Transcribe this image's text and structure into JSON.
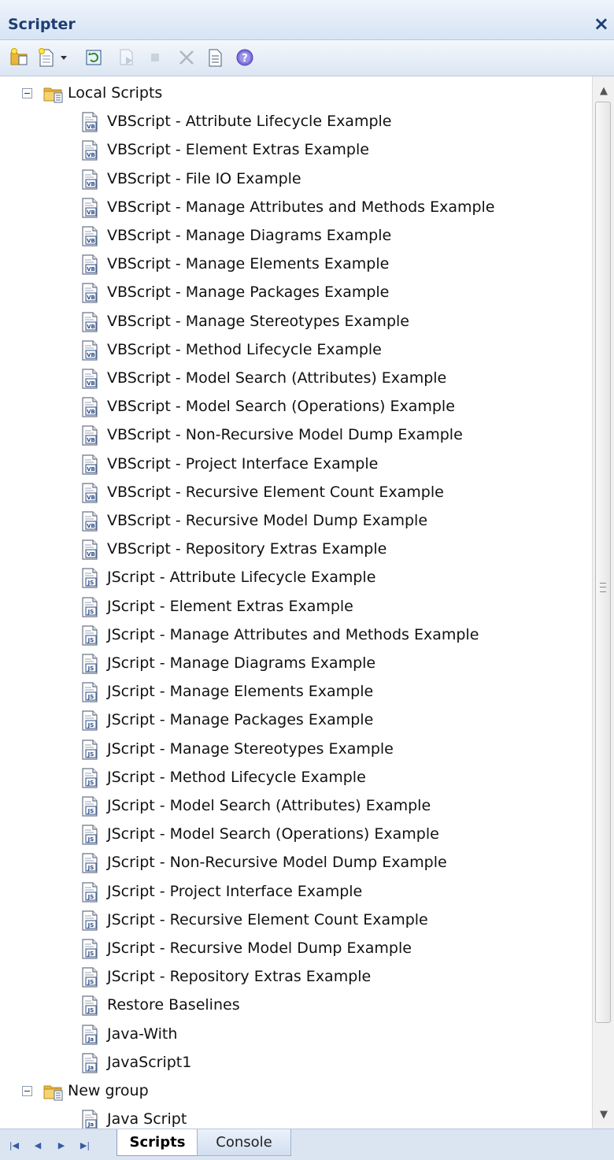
{
  "window": {
    "title": "Scripter",
    "close_glyph": "×"
  },
  "toolbar": {
    "buttons": [
      {
        "name": "new-group-button",
        "icon": "new-group-icon",
        "enabled": true
      },
      {
        "name": "new-script-button",
        "icon": "new-script-icon",
        "enabled": true
      },
      {
        "name": "new-script-dropdown",
        "icon": "chevron-down-icon",
        "enabled": true
      },
      {
        "name": "refresh-button",
        "icon": "refresh-icon",
        "enabled": true
      },
      {
        "name": "run-script-button",
        "icon": "run-script-icon",
        "enabled": false
      },
      {
        "name": "stop-script-button",
        "icon": "stop-icon",
        "enabled": false
      },
      {
        "name": "delete-button",
        "icon": "delete-icon",
        "enabled": false
      },
      {
        "name": "properties-button",
        "icon": "properties-icon",
        "enabled": true
      },
      {
        "name": "help-button",
        "icon": "help-icon",
        "enabled": true
      }
    ]
  },
  "tree": {
    "groups": [
      {
        "label": "Local Scripts",
        "expanded": true,
        "items": [
          {
            "label": "VBScript - Attribute Lifecycle Example",
            "type": "VB"
          },
          {
            "label": "VBScript - Element Extras Example",
            "type": "VB"
          },
          {
            "label": "VBScript - File IO Example",
            "type": "VB"
          },
          {
            "label": "VBScript - Manage Attributes and Methods Example",
            "type": "VB"
          },
          {
            "label": "VBScript - Manage Diagrams Example",
            "type": "VB"
          },
          {
            "label": "VBScript - Manage Elements Example",
            "type": "VB"
          },
          {
            "label": "VBScript - Manage Packages Example",
            "type": "VB"
          },
          {
            "label": "VBScript - Manage Stereotypes Example",
            "type": "VB"
          },
          {
            "label": "VBScript - Method Lifecycle Example",
            "type": "VB"
          },
          {
            "label": "VBScript - Model Search (Attributes) Example",
            "type": "VB"
          },
          {
            "label": "VBScript - Model Search (Operations) Example",
            "type": "VB"
          },
          {
            "label": "VBScript - Non-Recursive Model Dump Example",
            "type": "VB"
          },
          {
            "label": "VBScript - Project Interface Example",
            "type": "VB"
          },
          {
            "label": "VBScript - Recursive Element Count Example",
            "type": "VB"
          },
          {
            "label": "VBScript - Recursive Model Dump Example",
            "type": "VB"
          },
          {
            "label": "VBScript - Repository Extras Example",
            "type": "VB"
          },
          {
            "label": "JScript - Attribute Lifecycle Example",
            "type": "JS"
          },
          {
            "label": "JScript - Element Extras Example",
            "type": "JS"
          },
          {
            "label": "JScript - Manage Attributes and Methods Example",
            "type": "JS"
          },
          {
            "label": "JScript - Manage Diagrams Example",
            "type": "JS"
          },
          {
            "label": "JScript - Manage Elements Example",
            "type": "JS"
          },
          {
            "label": "JScript - Manage Packages Example",
            "type": "JS"
          },
          {
            "label": "JScript - Manage Stereotypes Example",
            "type": "JS"
          },
          {
            "label": "JScript - Method Lifecycle Example",
            "type": "JS"
          },
          {
            "label": "JScript - Model Search (Attributes) Example",
            "type": "JS"
          },
          {
            "label": "JScript - Model Search (Operations) Example",
            "type": "JS"
          },
          {
            "label": "JScript - Non-Recursive Model Dump Example",
            "type": "JS"
          },
          {
            "label": "JScript - Project Interface Example",
            "type": "JS"
          },
          {
            "label": "JScript - Recursive Element Count Example",
            "type": "JS"
          },
          {
            "label": "JScript - Recursive Model Dump Example",
            "type": "JS"
          },
          {
            "label": "JScript - Repository Extras Example",
            "type": "JS"
          },
          {
            "label": "Restore Baselines",
            "type": "JS"
          },
          {
            "label": "Java-With",
            "type": "Ja"
          },
          {
            "label": "JavaScript1",
            "type": "Ja"
          }
        ]
      },
      {
        "label": "New group",
        "expanded": true,
        "items": [
          {
            "label": "Java Script",
            "type": "Ja"
          }
        ]
      }
    ]
  },
  "scrollbar": {
    "up_glyph": "▲",
    "down_glyph": "▼"
  },
  "bottom": {
    "nav": [
      "|◀",
      "◀",
      "▶",
      "▶|"
    ],
    "tabs": [
      {
        "label": "Scripts",
        "active": true
      },
      {
        "label": "Console",
        "active": false
      }
    ]
  },
  "colors": {
    "title": "#1e3e73",
    "folder": "#e8b73a",
    "vb_badge": "#2c4e8a",
    "js_badge": "#2c4e8a"
  }
}
